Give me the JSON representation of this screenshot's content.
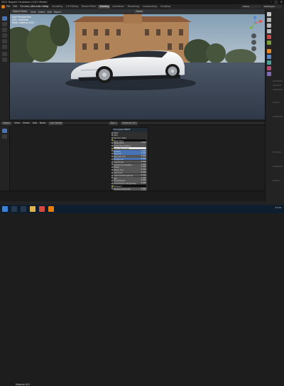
{
  "window": {
    "title": "2021 Bugatti Centodieci (2021 Model)",
    "controls": [
      "–",
      "□",
      "✕"
    ]
  },
  "menubar": {
    "menus": [
      "File",
      "Edit",
      "Render",
      "Window",
      "Help"
    ],
    "workspaces": [
      "Layout",
      "Modeling",
      "Sculpting",
      "UV Editing",
      "Texture Paint",
      "Shading",
      "Animation",
      "Rendering",
      "Compositing",
      "Scripting"
    ],
    "active_workspace": "Shading",
    "scene": "Scene",
    "view_layer": "ViewLayer"
  },
  "viewport": {
    "header": [
      "Object Mode",
      "View",
      "Select",
      "Add",
      "Object"
    ],
    "orientation": "Global",
    "info": [
      "User Perspective",
      "(30) Collection",
      "Mesh Lighting 2021"
    ]
  },
  "node_editor": {
    "header": [
      "Object",
      "View",
      "Select",
      "Add",
      "Node",
      "Use Nodes"
    ],
    "slot": "Slot 1",
    "material": "Material.001",
    "panel_title": "Principled BSDF",
    "rows": [
      {
        "label": "BSDF",
        "value": ""
      },
      {
        "label": "GGX",
        "value": ""
      },
      {
        "label": "Random Walk",
        "value": ""
      },
      {
        "label": "Base Color",
        "value": ""
      },
      {
        "label": "Subsurface",
        "value": "0.000"
      },
      {
        "label": "Subsurface Radius",
        "value": ""
      },
      {
        "label": "Subsurface Color",
        "value": ""
      },
      {
        "label": "Metallic",
        "value": "0.000"
      },
      {
        "label": "Specular",
        "value": "0.500"
      },
      {
        "label": "Specular Tint",
        "value": "0.000"
      },
      {
        "label": "Roughness",
        "value": "0.500"
      },
      {
        "label": "Anisotropic",
        "value": "0.000"
      },
      {
        "label": "Anisotropic Rotation",
        "value": "0.000"
      },
      {
        "label": "Sheen",
        "value": "0.000"
      },
      {
        "label": "Sheen Tint",
        "value": "0.500"
      },
      {
        "label": "Clearcoat",
        "value": "0.000"
      },
      {
        "label": "Clearcoat Roughness",
        "value": "0.030"
      },
      {
        "label": "IOR",
        "value": "1.450"
      },
      {
        "label": "Transmission",
        "value": "0.000"
      },
      {
        "label": "Transmission Roughness",
        "value": "0.000"
      },
      {
        "label": "Emission",
        "value": ""
      },
      {
        "label": "Emission Strength",
        "value": "1.000"
      },
      {
        "label": "Alpha",
        "value": "1.000"
      },
      {
        "label": "Normal",
        "value": ""
      },
      {
        "label": "Clearcoat Normal",
        "value": ""
      },
      {
        "label": "Tangent",
        "value": ""
      }
    ],
    "footer_material": "Material.001"
  },
  "colors": {
    "accent": "#4772b3",
    "logo": "#e87d0d",
    "taskbar": "#0f1e2f",
    "car_body": "#f2f2f2",
    "ground": "#3a4554"
  },
  "taskbar": {
    "icons": [
      "windows-icon",
      "search-icon",
      "taskview-icon",
      "folder-icon",
      "chrome-icon",
      "blender-icon"
    ],
    "time": "11:24"
  }
}
